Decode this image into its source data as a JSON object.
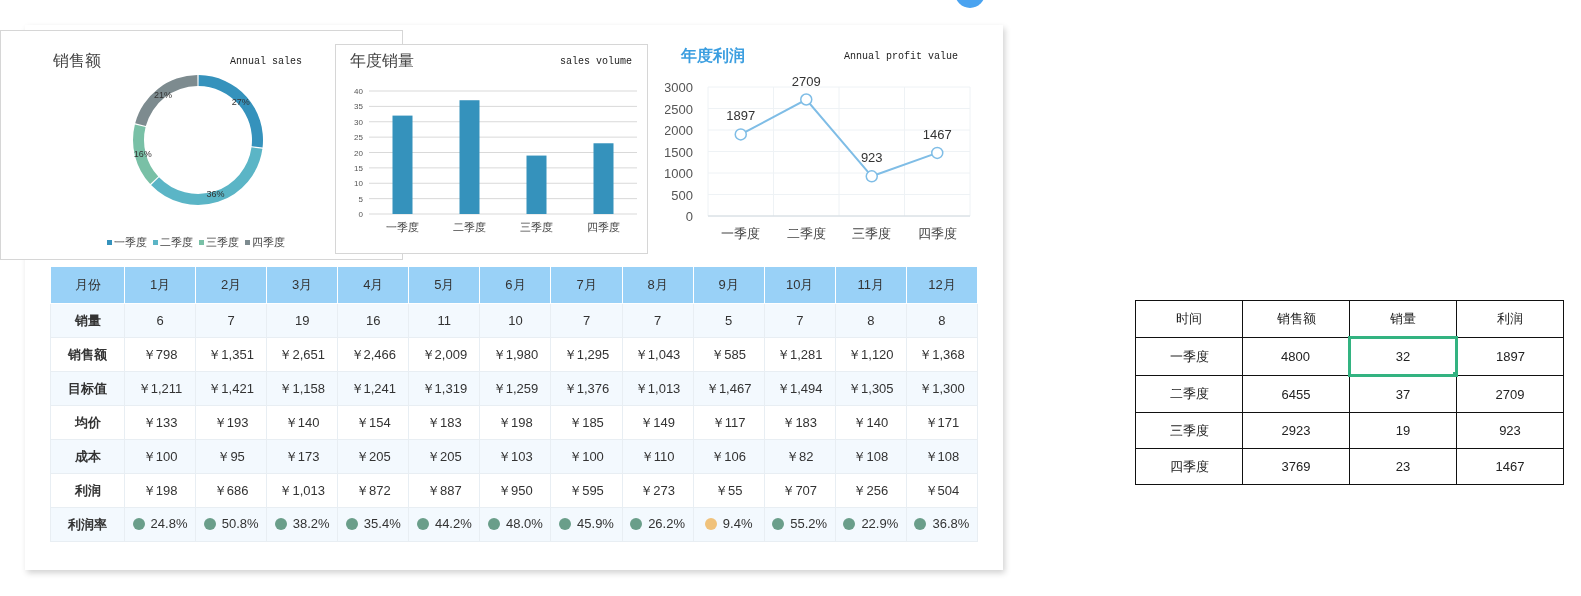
{
  "donut_chart": {
    "title": "销售额",
    "subtitle": "Annual sales",
    "chart_data": {
      "type": "donut",
      "categories": [
        "一季度",
        "二季度",
        "三季度",
        "四季度"
      ],
      "series": [
        {
          "values": [
            27,
            36,
            16,
            21
          ]
        }
      ],
      "value_labels": [
        "27%",
        "36%",
        "16%",
        "21%"
      ]
    },
    "legend": [
      {
        "color": "#3592bc"
      },
      {
        "color": "#5bb5c6"
      },
      {
        "color": "#79c0a6"
      },
      {
        "color": "#7d8b8f"
      }
    ]
  },
  "bar_chart": {
    "title": "年度销量",
    "subtitle": "sales volume",
    "chart_data": {
      "type": "bar",
      "categories": [
        "一季度",
        "二季度",
        "三季度",
        "四季度"
      ],
      "series": [
        {
          "color": "#3592bc",
          "values": [
            32,
            37,
            19,
            23
          ]
        }
      ],
      "grid": true,
      "ylim": [
        0,
        40
      ],
      "yticks": [
        0,
        5,
        10,
        15,
        20,
        25,
        30,
        35,
        40
      ]
    }
  },
  "line_chart": {
    "title": "年度利润",
    "subtitle": "Annual profit value",
    "chart_data": {
      "type": "line",
      "categories": [
        "一季度",
        "二季度",
        "三季度",
        "四季度"
      ],
      "series": [
        {
          "color": "#7fbde6",
          "marker": "circle",
          "values": [
            1897,
            2709,
            923,
            1467
          ]
        }
      ],
      "grid": true,
      "ylim": [
        0,
        3000
      ],
      "yticks": [
        0,
        500,
        1000,
        1500,
        2000,
        2500,
        3000
      ],
      "data_labels": true
    }
  },
  "monthly_table": {
    "row_header_title": "月份",
    "columns": [
      "1月",
      "2月",
      "3月",
      "4月",
      "5月",
      "6月",
      "7月",
      "8月",
      "9月",
      "10月",
      "11月",
      "12月"
    ],
    "rows": [
      {
        "kind": "value",
        "label": "销量",
        "cells": [
          "6",
          "7",
          "19",
          "16",
          "11",
          "10",
          "7",
          "7",
          "5",
          "7",
          "8",
          "8"
        ]
      },
      {
        "kind": "value",
        "label": "销售额",
        "cells": [
          "￥798",
          "￥1,351",
          "￥2,651",
          "￥2,466",
          "￥2,009",
          "￥1,980",
          "￥1,295",
          "￥1,043",
          "￥585",
          "￥1,281",
          "￥1,120",
          "￥1,368"
        ]
      },
      {
        "kind": "value",
        "label": "目标值",
        "cells": [
          "￥1,211",
          "￥1,421",
          "￥1,158",
          "￥1,241",
          "￥1,319",
          "￥1,259",
          "￥1,376",
          "￥1,013",
          "￥1,467",
          "￥1,494",
          "￥1,305",
          "￥1,300"
        ]
      },
      {
        "kind": "value",
        "label": "均价",
        "cells": [
          "￥133",
          "￥193",
          "￥140",
          "￥154",
          "￥183",
          "￥198",
          "￥185",
          "￥149",
          "￥117",
          "￥183",
          "￥140",
          "￥171"
        ]
      },
      {
        "kind": "value",
        "label": "成本",
        "cells": [
          "￥100",
          "￥95",
          "￥173",
          "￥205",
          "￥205",
          "￥103",
          "￥100",
          "￥110",
          "￥106",
          "￥82",
          "￥108",
          "￥108"
        ]
      },
      {
        "kind": "value",
        "label": "利润",
        "cells": [
          "￥198",
          "￥686",
          "￥1,013",
          "￥872",
          "￥887",
          "￥950",
          "￥595",
          "￥273",
          "￥55",
          "￥707",
          "￥256",
          "￥504"
        ]
      },
      {
        "kind": "rate",
        "label": "利润率",
        "cells": [
          {
            "text": "24.8%",
            "color": "#6a9e8a"
          },
          {
            "text": "50.8%",
            "color": "#6a9e8a"
          },
          {
            "text": "38.2%",
            "color": "#6a9e8a"
          },
          {
            "text": "35.4%",
            "color": "#6a9e8a"
          },
          {
            "text": "44.2%",
            "color": "#6a9e8a"
          },
          {
            "text": "48.0%",
            "color": "#6a9e8a"
          },
          {
            "text": "45.9%",
            "color": "#6a9e8a"
          },
          {
            "text": "26.2%",
            "color": "#6a9e8a"
          },
          {
            "text": "9.4%",
            "color": "#f0c27b"
          },
          {
            "text": "55.2%",
            "color": "#6a9e8a"
          },
          {
            "text": "22.9%",
            "color": "#6a9e8a"
          },
          {
            "text": "36.8%",
            "color": "#6a9e8a"
          }
        ]
      }
    ]
  },
  "data_table": {
    "columns": [
      "时间",
      "销售额",
      "销量",
      "利润"
    ],
    "rows": [
      {
        "cells": [
          {
            "text": "一季度",
            "selected": false
          },
          {
            "text": "4800",
            "selected": false
          },
          {
            "text": "32",
            "selected": true
          },
          {
            "text": "1897",
            "selected": false
          }
        ]
      },
      {
        "cells": [
          {
            "text": "二季度",
            "selected": false
          },
          {
            "text": "6455",
            "selected": false
          },
          {
            "text": "37",
            "selected": false
          },
          {
            "text": "2709",
            "selected": false
          }
        ]
      },
      {
        "cells": [
          {
            "text": "三季度",
            "selected": false
          },
          {
            "text": "2923",
            "selected": false
          },
          {
            "text": "19",
            "selected": false
          },
          {
            "text": "923",
            "selected": false
          }
        ]
      },
      {
        "cells": [
          {
            "text": "四季度",
            "selected": false
          },
          {
            "text": "3769",
            "selected": false
          },
          {
            "text": "23",
            "selected": false
          },
          {
            "text": "1467",
            "selected": false
          }
        ]
      }
    ]
  }
}
